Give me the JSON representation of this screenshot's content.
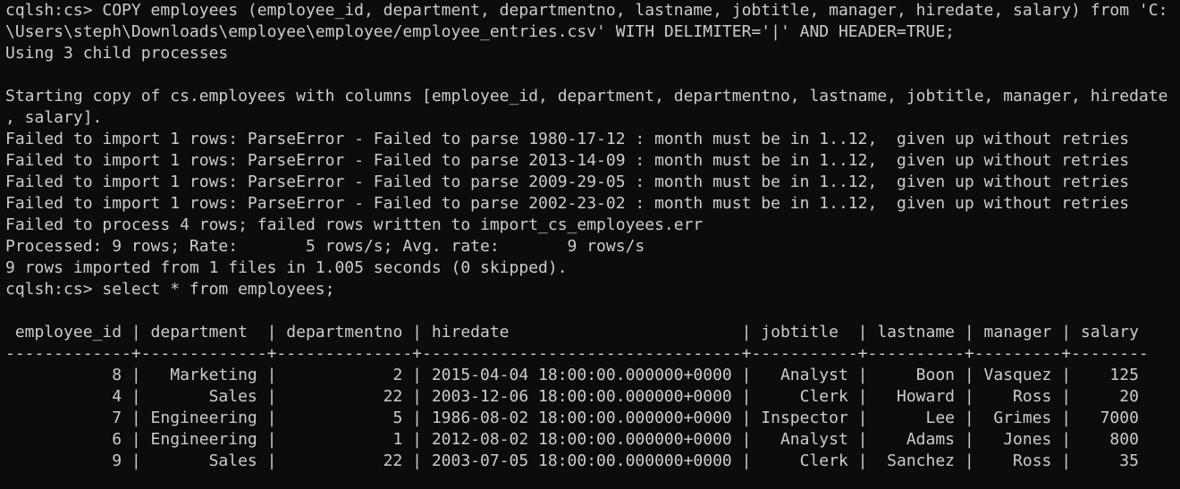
{
  "terminal": {
    "background": "#0c0c0c",
    "foreground": "#cccccc",
    "lines": [
      "cqlsh:cs> COPY employees (employee_id, department, departmentno, lastname, jobtitle, manager, hiredate, salary) from 'C:",
      "\\Users\\steph\\Downloads\\employee\\employee/employee_entries.csv' WITH DELIMITER='|' AND HEADER=TRUE;",
      "Using 3 child processes",
      "",
      "Starting copy of cs.employees with columns [employee_id, department, departmentno, lastname, jobtitle, manager, hiredate",
      ", salary].",
      "Failed to import 1 rows: ParseError - Failed to parse 1980-17-12 : month must be in 1..12,  given up without retries",
      "Failed to import 1 rows: ParseError - Failed to parse 2013-14-09 : month must be in 1..12,  given up without retries",
      "Failed to import 1 rows: ParseError - Failed to parse 2009-29-05 : month must be in 1..12,  given up without retries",
      "Failed to import 1 rows: ParseError - Failed to parse 2002-23-02 : month must be in 1..12,  given up without retries",
      "Failed to process 4 rows; failed rows written to import_cs_employees.err",
      "Processed: 9 rows; Rate:       5 rows/s; Avg. rate:       9 rows/s",
      "9 rows imported from 1 files in 1.005 seconds (0 skipped).",
      "cqlsh:cs> select * from employees;",
      "",
      " employee_id | department  | departmentno | hiredate                        | jobtitle  | lastname | manager | salary",
      "-------------+-------------+--------------+---------------------------------+-----------+----------+---------+--------",
      "           8 |   Marketing |            2 | 2015-04-04 18:00:00.000000+0000 |   Analyst |     Boon | Vasquez |    125",
      "           4 |       Sales |           22 | 2003-12-06 18:00:00.000000+0000 |     Clerk |   Howard |    Ross |     20",
      "           7 | Engineering |            5 | 1986-08-02 18:00:00.000000+0000 | Inspector |      Lee |  Grimes |   7000",
      "           6 | Engineering |            1 | 2012-08-02 18:00:00.000000+0000 |   Analyst |    Adams |   Jones |    800",
      "           9 |       Sales |           22 | 2003-07-05 18:00:00.000000+0000 |     Clerk |  Sanchez |    Ross |     35"
    ]
  }
}
